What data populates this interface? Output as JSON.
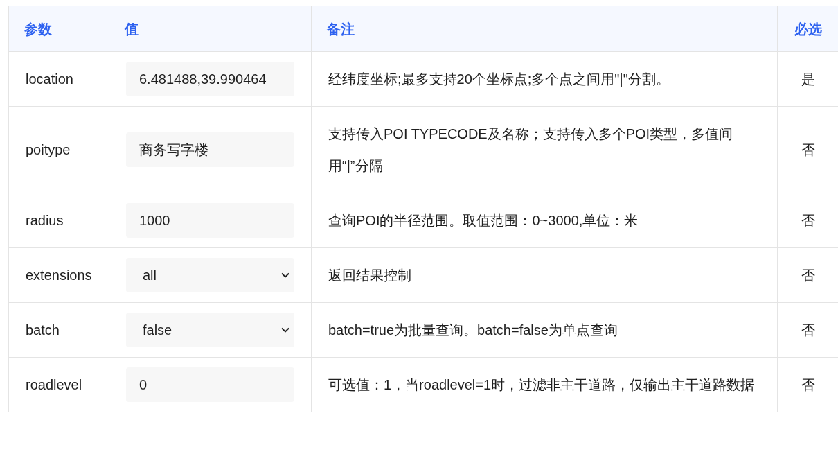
{
  "table": {
    "columns": [
      "参数",
      "值",
      "备注",
      "必选"
    ],
    "rows": [
      {
        "param": "location",
        "field": {
          "kind": "input",
          "value": "6.481488,39.990464"
        },
        "note": "经纬度坐标;最多支持20个坐标点;多个点之间用\"|\"分割。",
        "required": "是"
      },
      {
        "param": "poitype",
        "field": {
          "kind": "input",
          "value": "商务写字楼"
        },
        "note": "支持传入POI TYPECODE及名称；支持传入多个POI类型，多值间用“|”分隔",
        "required": "否"
      },
      {
        "param": "radius",
        "field": {
          "kind": "input",
          "value": "1000"
        },
        "note": "查询POI的半径范围。取值范围：0~3000,单位：米",
        "required": "否"
      },
      {
        "param": "extensions",
        "field": {
          "kind": "select",
          "value": "all"
        },
        "note": "返回结果控制",
        "required": "否"
      },
      {
        "param": "batch",
        "field": {
          "kind": "select",
          "value": "false"
        },
        "note": "batch=true为批量查询。batch=false为单点查询",
        "required": "否"
      },
      {
        "param": "roadlevel",
        "field": {
          "kind": "input",
          "value": "0"
        },
        "note": "可选值：1，当roadlevel=1时，过滤非主干道路，仅输出主干道路数据",
        "required": "否"
      }
    ]
  }
}
